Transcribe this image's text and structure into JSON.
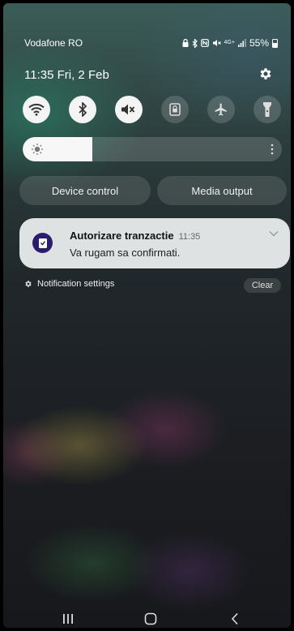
{
  "status": {
    "carrier": "Vodafone RO",
    "signal_text": "4G+",
    "battery": "55%"
  },
  "header": {
    "time": "11:35",
    "date": "Fri, 2 Feb"
  },
  "toggles": [
    {
      "icon": "wifi-icon",
      "state": "on"
    },
    {
      "icon": "bluetooth-icon",
      "state": "on"
    },
    {
      "icon": "mute-icon",
      "state": "on"
    },
    {
      "icon": "lock-icon",
      "state": "off"
    },
    {
      "icon": "airplane-icon",
      "state": "off"
    },
    {
      "icon": "flashlight-icon",
      "state": "off"
    }
  ],
  "brightness": {
    "level": 0.27
  },
  "buttons": {
    "device_control": "Device control",
    "media_output": "Media output"
  },
  "notification": {
    "title": "Autorizare tranzactie",
    "time": "11:35",
    "body": "Va rugam sa confirmati."
  },
  "footer": {
    "settings": "Notification settings",
    "clear": "Clear"
  },
  "colors": {
    "app_icon_bg": "#2a1e6a",
    "card_bg": "#eef0f0"
  }
}
